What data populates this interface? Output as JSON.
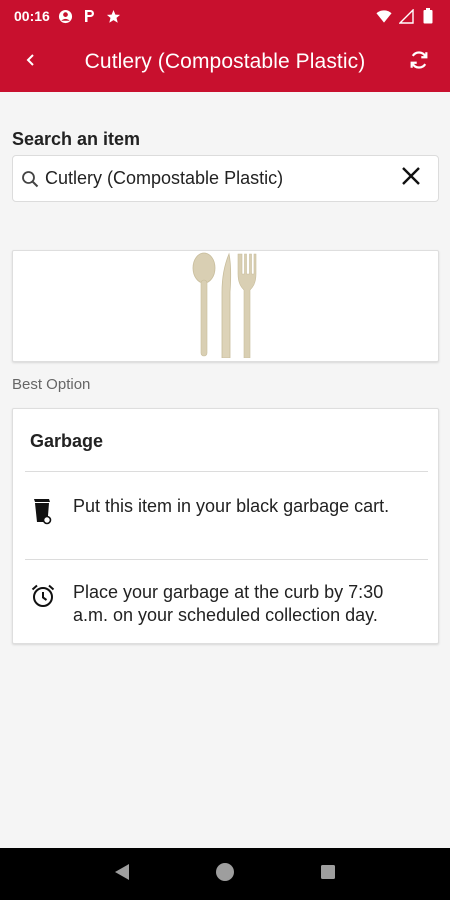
{
  "status_bar": {
    "time": "00:16",
    "icons": [
      "account-circle-icon",
      "parking-icon",
      "star-icon",
      "wifi-icon",
      "signal-icon",
      "battery-icon"
    ]
  },
  "app_bar": {
    "title": "Cutlery (Compostable Plastic)",
    "back_icon": "chevron-left-icon",
    "refresh_icon": "refresh-icon"
  },
  "search": {
    "label": "Search an item",
    "value": "Cutlery (Compostable Plastic)",
    "search_icon": "search-icon",
    "clear_icon": "close-icon"
  },
  "item_image": {
    "description_icon": "cutlery-image"
  },
  "best_option": {
    "label": "Best Option",
    "heading": "Garbage",
    "rows": [
      {
        "icon": "garbage-cart-icon",
        "text": "Put this item in your black garbage cart."
      },
      {
        "icon": "alarm-clock-icon",
        "text": "Place your garbage at the curb by 7:30 a.m. on your scheduled collection day."
      }
    ]
  },
  "colors": {
    "brand": "#c8102e",
    "background": "#f5f5f5",
    "nav_bar": "#000000"
  }
}
